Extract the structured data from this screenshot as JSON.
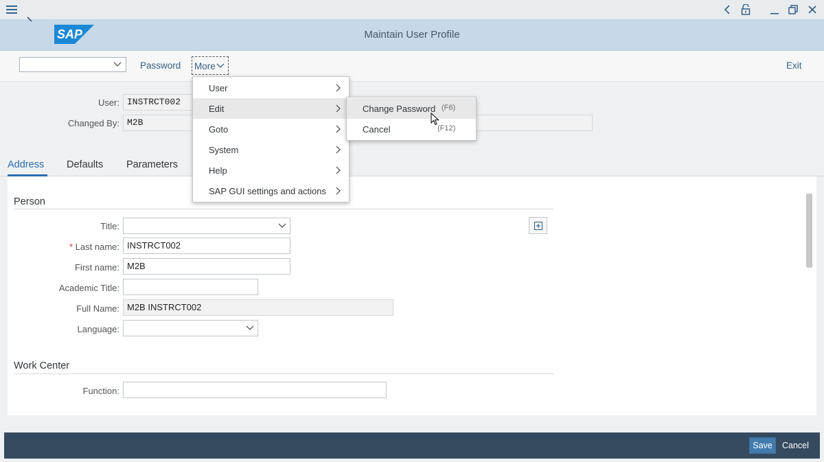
{
  "header": {
    "title": "Maintain User Profile"
  },
  "toolbar": {
    "select_value": "",
    "password_label": "Password",
    "more_label": "More",
    "exit_label": "Exit"
  },
  "fields": {
    "user_label": "User:",
    "user_value": "INSTRCT002",
    "changed_by_label": "Changed By:",
    "changed_by_value": "M2B"
  },
  "tabs": [
    {
      "label": "Address",
      "active": true
    },
    {
      "label": "Defaults"
    },
    {
      "label": "Parameters"
    }
  ],
  "person": {
    "section_title": "Person",
    "title_label": "Title:",
    "title_value": "",
    "required_marker": "*",
    "last_name_label": "Last name:",
    "last_name_value": "INSTRCT002",
    "first_name_label": "First name:",
    "first_name_value": "M2B",
    "academic_title_label": "Academic Title:",
    "academic_title_value": "",
    "full_name_label": "Full Name:",
    "full_name_value": "M2B INSTRCT002",
    "language_label": "Language:",
    "language_value": ""
  },
  "work_center": {
    "section_title": "Work Center",
    "function_label": "Function:",
    "function_value": ""
  },
  "more_menu": {
    "items": [
      {
        "label": "User"
      },
      {
        "label": "Edit"
      },
      {
        "label": "Goto"
      },
      {
        "label": "System"
      },
      {
        "label": "Help"
      },
      {
        "label": "SAP GUI settings and actions"
      }
    ]
  },
  "edit_submenu": {
    "items": [
      {
        "label": "Change Password",
        "shortcut": "(F6)"
      },
      {
        "label": "Cancel",
        "shortcut": "(F12)"
      }
    ]
  },
  "footer": {
    "save_label": "Save",
    "cancel_label": "Cancel"
  },
  "colors": {
    "accent": "#346187",
    "header_bg": "#c7d9e8",
    "footer_bg": "#354a5f",
    "primary_button": "#427cac"
  }
}
